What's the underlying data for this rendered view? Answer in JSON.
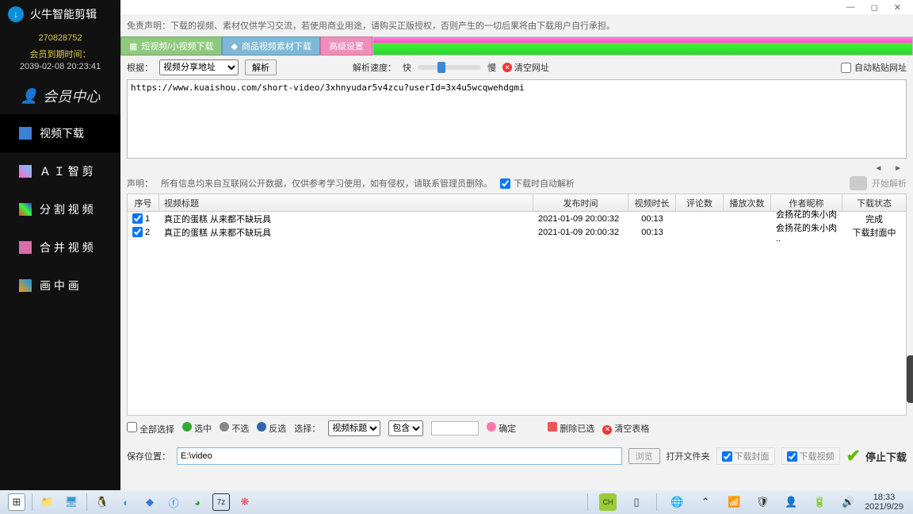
{
  "window": {
    "minimize": "—",
    "maximize": "◻",
    "close": "✕"
  },
  "app": {
    "name": "火牛智能剪辑",
    "member_id": "270828752",
    "expire_label": "会员到期时间：",
    "expire_date": "2039-02-08 20:23:41",
    "member_center": "会员中心"
  },
  "nav": {
    "download": "视频下载",
    "ai": "Ａ Ｉ 智 剪",
    "split": "分 割 视 频",
    "merge": "合 并 视 频",
    "pip": "画 中 画"
  },
  "disclaimer": "免责声明：下载的视频、素材仅供学习交流，若使用商业用途，请购买正版授权，否则产生的一切后果将由下载用户自行承担。",
  "tabs": {
    "short": "短视频/小视频下载",
    "product": "商品视频素材下载",
    "advanced": "高级设置"
  },
  "parse": {
    "basis_label": "根据：",
    "basis_value": "视频分享地址",
    "parse_btn": "解析",
    "speed_label": "解析速度：",
    "fast": "快",
    "slow": "慢",
    "clear_url": "清空网址",
    "auto_paste": "自动粘贴网址"
  },
  "url": "https://www.kuaishou.com/short-video/3xhnyudar5v4zcu?userId=3x4u5wcqwehdgmi",
  "note": {
    "label": "声明：",
    "text": "所有信息均来自互联网公开数据，仅供参考学习使用，如有侵权，请联系管理员删除。",
    "auto_parse": "下载时自动解析",
    "start": "开始解析"
  },
  "table": {
    "headers": {
      "idx": "序号",
      "title": "视频标题",
      "pub": "发布时间",
      "dur": "视频时长",
      "cm": "评论数",
      "play": "播放次数",
      "auth": "作者昵称",
      "stat": "下载状态"
    },
    "rows": [
      {
        "idx": "1",
        "title": "真正的蛋糕  从来都不缺玩具",
        "pub": "2021-01-09 20:00:32",
        "dur": "00:13",
        "cm": "",
        "play": "",
        "auth": "会扬花的朱小肉 ..",
        "stat": "完成"
      },
      {
        "idx": "2",
        "title": "真正的蛋糕  从来都不缺玩具",
        "pub": "2021-01-09 20:00:32",
        "dur": "00:13",
        "cm": "",
        "play": "",
        "auth": "会扬花的朱小肉 ..",
        "stat": "下载封面中"
      }
    ]
  },
  "selrow": {
    "all": "全部选择",
    "sel": "选中",
    "unsel": "不选",
    "rev": "反选",
    "filter_label": "选择：",
    "filter_field": "视频标题",
    "filter_op": "包含",
    "confirm": "确定",
    "del": "删除已选",
    "clear": "清空表格"
  },
  "save": {
    "label": "保存位置：",
    "path": "E:\\video",
    "browse": "浏览",
    "open": "打开文件夹",
    "dl_cover": "下载封面",
    "dl_video": "下载视频",
    "stop": "停止下载"
  },
  "taskbar": {
    "time": "18:33",
    "date": "2021/9/29"
  }
}
